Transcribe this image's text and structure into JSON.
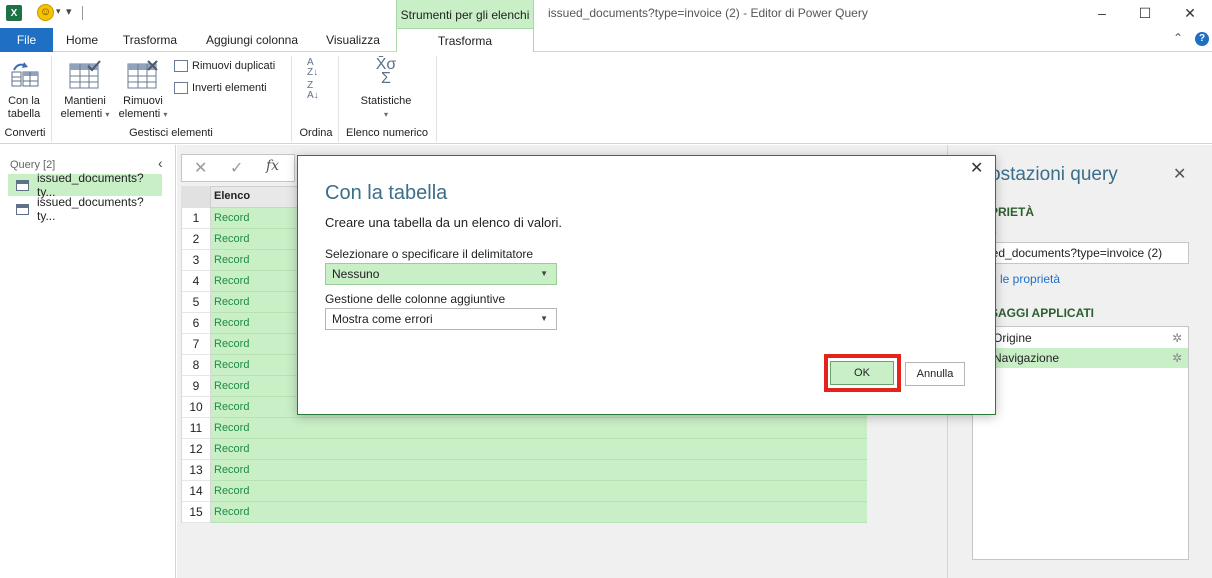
{
  "titlebar": {
    "logo": "X",
    "contextual_tab": "Strumenti per gli elenchi",
    "window_title": "issued_documents?type=invoice (2) - Editor di Power Query"
  },
  "tabs": {
    "file": "File",
    "home": "Home",
    "trasforma": "Trasforma",
    "aggiungi_colonna": "Aggiungi colonna",
    "visualizza": "Visualizza",
    "trasforma_active": "Trasforma"
  },
  "ribbon": {
    "con_la_tabella_1": "Con la",
    "con_la_tabella_2": "tabella",
    "mantieni_1": "Mantieni",
    "mantieni_2": "elementi",
    "rimuovi_1": "Rimuovi",
    "rimuovi_2": "elementi",
    "rimuovi_duplicati": "Rimuovi duplicati",
    "inverti_elementi": "Inverti elementi",
    "statistiche": "Statistiche",
    "groups": {
      "converti": "Converti",
      "gestisci": "Gestisci elementi",
      "ordina": "Ordina",
      "elenco_numerico": "Elenco numerico"
    }
  },
  "query_pane": {
    "title": "Query [2]",
    "items": [
      "issued_documents?ty...",
      "issued_documents?ty..."
    ]
  },
  "grid": {
    "column_header": "Elenco",
    "rows": [
      {
        "n": "1",
        "v": "Record"
      },
      {
        "n": "2",
        "v": "Record"
      },
      {
        "n": "3",
        "v": "Record"
      },
      {
        "n": "4",
        "v": "Record"
      },
      {
        "n": "5",
        "v": "Record"
      },
      {
        "n": "6",
        "v": "Record"
      },
      {
        "n": "7",
        "v": "Record"
      },
      {
        "n": "8",
        "v": "Record"
      },
      {
        "n": "9",
        "v": "Record"
      },
      {
        "n": "10",
        "v": "Record"
      },
      {
        "n": "11",
        "v": "Record"
      },
      {
        "n": "12",
        "v": "Record"
      },
      {
        "n": "13",
        "v": "Record"
      },
      {
        "n": "14",
        "v": "Record"
      },
      {
        "n": "15",
        "v": "Record"
      }
    ]
  },
  "settings": {
    "title": "ostazioni query",
    "properties_header": "PRIETÀ",
    "name_label": "e",
    "name_value": "ued_documents?type=invoice (2)",
    "all_props_link": "e le proprietà",
    "steps_header": "SAGGI APPLICATI",
    "steps": [
      "Origine",
      "Navigazione"
    ]
  },
  "dialog": {
    "title": "Con la tabella",
    "description": "Creare una tabella da un elenco di valori.",
    "delimiter_label": "Selezionare o specificare il delimitatore",
    "delimiter_value": "Nessuno",
    "extra_cols_label": "Gestione delle colonne aggiuntive",
    "extra_cols_value": "Mostra come errori",
    "ok": "OK",
    "cancel": "Annulla"
  }
}
